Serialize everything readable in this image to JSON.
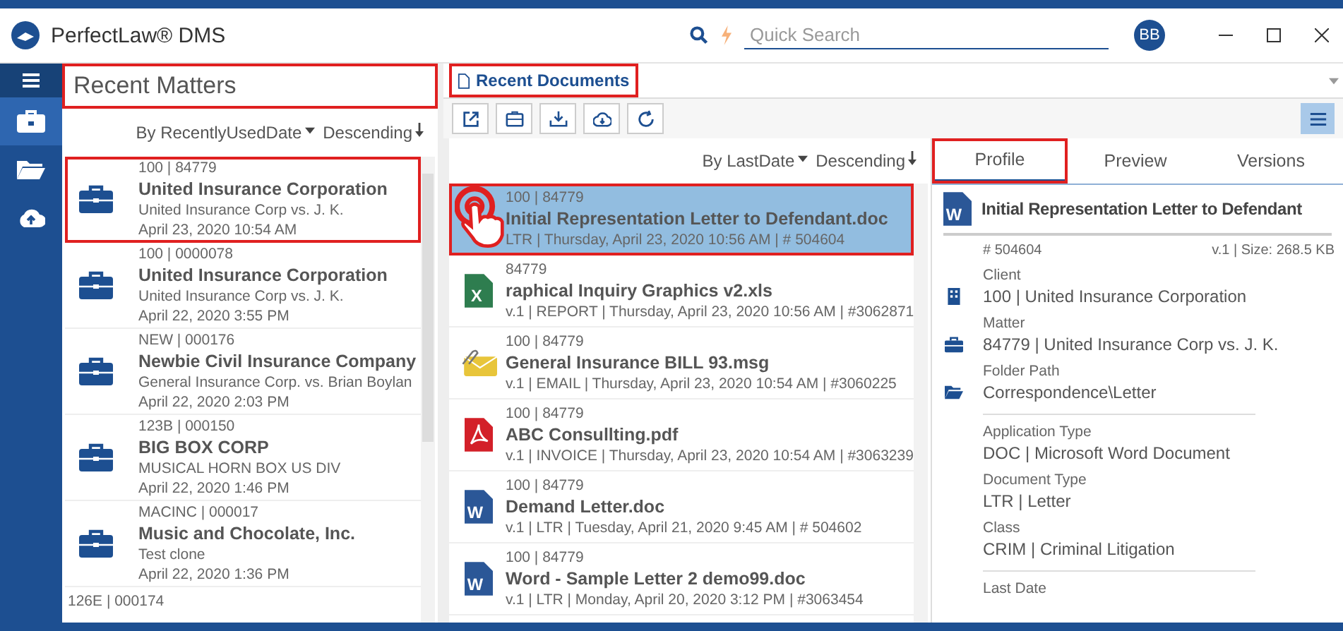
{
  "app": {
    "title": "PerfectLaw® DMS",
    "search": {
      "placeholder": "Quick Search"
    },
    "user": "BB"
  },
  "nav": [
    {
      "kind": "menu",
      "selected": false
    },
    {
      "kind": "briefcase",
      "selected": true
    },
    {
      "kind": "folder",
      "selected": false
    },
    {
      "kind": "upload",
      "selected": false
    }
  ],
  "matters": {
    "title": "Recent Matters",
    "highlighted": true,
    "sort": "By RecentlyUsedDate",
    "order": "Descending",
    "items": [
      {
        "code": "100 | 84779",
        "name": "United Insurance Corporation",
        "desc": "United Insurance Corp vs. J. K.",
        "date": "April 23, 2020 10:54 AM",
        "highlighted": true
      },
      {
        "code": "100 | 0000078",
        "name": "United Insurance Corporation",
        "desc": "United Insurance Corp vs. J. K.",
        "date": "April 22, 2020 3:55 PM",
        "highlighted": false
      },
      {
        "code": "NEW | 000176",
        "name": "Newbie Civil Insurance Company",
        "desc": "General Insurance Corp. vs. Brian Boylan",
        "date": "April 22, 2020 2:03 PM",
        "highlighted": false
      },
      {
        "code": "123B | 000150",
        "name": "BIG BOX CORP",
        "desc": "MUSICAL HORN BOX US DIV",
        "date": "April 22, 2020 1:46 PM",
        "highlighted": false
      },
      {
        "code": "MACINC | 000017",
        "name": "Music and Chocolate, Inc.",
        "desc": "Test clone",
        "date": "April 22, 2020 1:36 PM",
        "highlighted": false
      },
      {
        "code": "126E | 000174",
        "highlighted": false
      }
    ]
  },
  "documents": {
    "tab": "Recent Documents",
    "highlighted": true,
    "sort": "By LastDate",
    "order": "Descending",
    "items": [
      {
        "code": "100 | 84779",
        "name": "Initial Representation Letter to Defendant.doc",
        "meta": "LTR | Thursday, April 23, 2020 10:56 AM | # 504604",
        "selected": true,
        "highlighted": true
      },
      {
        "kind": "excel",
        "badge": "X",
        "code": "84779",
        "name": "raphical Inquiry Graphics v2.xls",
        "meta": "v.1 | REPORT | Thursday, April 23, 2020 10:56 AM | #3062871",
        "selected": false,
        "highlighted": false
      },
      {
        "kind": "email",
        "code": "100 | 84779",
        "name": "General Insurance  BILL 93.msg",
        "meta": "v.1 | EMAIL | Thursday, April 23, 2020 10:54 AM | #3060225",
        "selected": false,
        "highlighted": false
      },
      {
        "kind": "pdf",
        "code": "100 | 84779",
        "name": "ABC Consullting.pdf",
        "meta": "v.1 | INVOICE | Thursday, April 23, 2020 10:54 AM | #3063239",
        "selected": false,
        "highlighted": false
      },
      {
        "kind": "word",
        "badge": "W",
        "code": "100 | 84779",
        "name": "Demand Letter.doc",
        "meta": "v.1 | LTR | Tuesday, April 21, 2020 9:45 AM | # 504602",
        "selected": false,
        "highlighted": false
      },
      {
        "kind": "word",
        "badge": "W",
        "code": "100 | 84779",
        "name": "Word - Sample Letter 2 demo99.doc",
        "meta": "v.1 | LTR | Monday, April 20, 2020 3:12 PM | #3063454",
        "selected": false,
        "highlighted": false
      }
    ]
  },
  "toolbar": [
    {
      "kind": "open"
    },
    {
      "kind": "briefcase"
    },
    {
      "kind": "checkin"
    },
    {
      "kind": "download"
    },
    {
      "kind": "refresh"
    }
  ],
  "profile": {
    "tabs": [
      {
        "label": "Profile",
        "selected": true,
        "highlighted": true
      },
      {
        "label": "Preview",
        "selected": false,
        "highlighted": false
      },
      {
        "label": "Versions",
        "selected": false,
        "highlighted": false
      }
    ],
    "title": "Initial Representation Letter to Defendant",
    "badge": "W",
    "number": "# 504604",
    "version": "v.1 | Size: 268.5 KB",
    "fields": [
      {
        "label": "Client",
        "value": "100 | United Insurance Corporation",
        "kind": "building",
        "divider": false
      },
      {
        "label": "Matter",
        "value": "84779 | United Insurance Corp vs. J. K.",
        "kind": "briefcase",
        "divider": false
      },
      {
        "label": "Folder Path",
        "value": "Correspondence\\Letter",
        "kind": "folder",
        "divider": true
      },
      {
        "label": "Application Type",
        "value": "DOC | Microsoft Word Document",
        "divider": false
      },
      {
        "label": "Document Type",
        "value": "LTR | Letter",
        "divider": false
      },
      {
        "label": "Class",
        "value": "CRIM | Criminal Litigation",
        "divider": true
      },
      {
        "label": "Last Date",
        "divider": false
      }
    ]
  }
}
